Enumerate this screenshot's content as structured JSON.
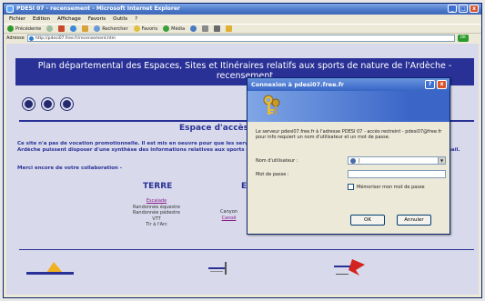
{
  "window": {
    "title": "PDESI 07 - recensement - Microsoft Internet Explorer",
    "minimize": "_",
    "maximize": "□",
    "close": "x"
  },
  "menu": [
    "Fichier",
    "Edition",
    "Affichage",
    "Favoris",
    "Outils",
    "?"
  ],
  "toolbar": {
    "back_label": "Précédente",
    "search_label": "Rechercher",
    "favorites_label": "Favoris",
    "media_label": "Média"
  },
  "address": {
    "label": "Adresse",
    "url": "http://pdesi07.free.fr/recensement.htm",
    "go_label": "OK"
  },
  "page": {
    "banner_text": "Plan départemental des Espaces, Sites et Itinéraires relatifs aux sports de nature de l'Ardèche - recensement",
    "heading": "Espace d'accès",
    "paragraph": "Ce site n'a pas de vocation promotionnelle. Il est mis en oeuvre pour que les services de l'Etat et des collectivités locales et les membres de la CDESI en Ardèche puissent disposer d'une synthèse des informations relatives aux sports de nature. Si vous constatez une erreur, veuillez nous en informer par mail.",
    "thanks": "Merci encore de votre collaboration -",
    "terre": {
      "title": "TERRE",
      "items": [
        "Escalade",
        "Randonnée équestre",
        "Randonnée pédestre",
        "VTT",
        "Tir à l'Arc"
      ]
    },
    "eau": {
      "title": "E",
      "items": [
        "Canyon",
        "Canoë"
      ]
    },
    "logos": [
      "logo-ardeche",
      "logo-conseil-general",
      "logo-jeunesse-sports"
    ]
  },
  "dialog": {
    "title": "Connexion à pdesi07.free.fr",
    "help": "?",
    "close": "x",
    "message": "Le serveur pdesi07.free.fr à l'adresse PDESI 07 - accès restreint - pdesi07@free.fr pour info requiert un nom d'utilisateur et un mot de passe.",
    "username_label": "Nom d'utilisateur :",
    "username_value": "|",
    "password_label": "Mot de passe :",
    "remember_label": "Mémoriser mon mot de passe",
    "ok_label": "OK",
    "cancel_label": "Annuler"
  }
}
